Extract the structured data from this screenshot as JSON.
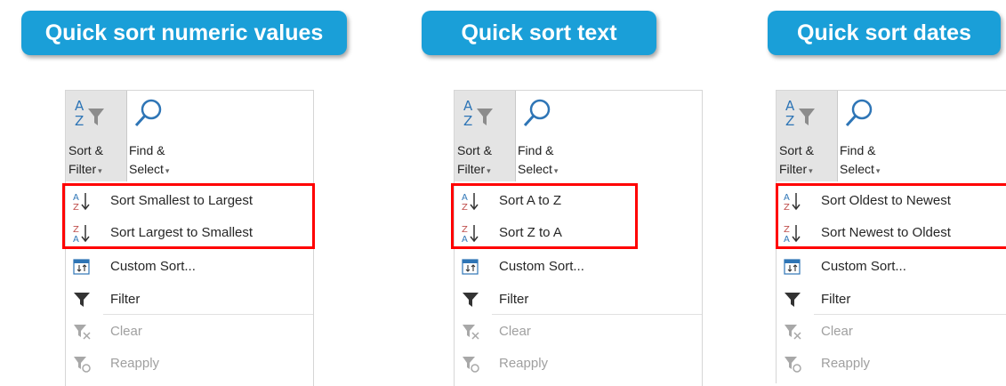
{
  "banners": [
    "Quick sort numeric values",
    "Quick sort text",
    "Quick sort dates"
  ],
  "ribbon": {
    "sort_filter": {
      "line1": "Sort &",
      "line2": "Filter",
      "icon": "sort-filter-icon"
    },
    "find_select": {
      "line1": "Find &",
      "line2": "Select",
      "icon": "magnifier-icon"
    },
    "caret": "▾"
  },
  "panels": [
    {
      "sort_asc": "Sort Smallest to Largest",
      "sort_desc": "Sort Largest to Smallest",
      "custom_sort": "Custom Sort...",
      "filter": "Filter",
      "clear": "Clear",
      "reapply": "Reapply"
    },
    {
      "sort_asc": "Sort A to Z",
      "sort_desc": "Sort Z to A",
      "custom_sort": "Custom Sort...",
      "filter": "Filter",
      "clear": "Clear",
      "reapply": "Reapply"
    },
    {
      "sort_asc": "Sort Oldest to Newest",
      "sort_desc": "Sort Newest to Oldest",
      "custom_sort": "Custom Sort...",
      "filter": "Filter",
      "clear": "Clear",
      "reapply": "Reapply"
    }
  ],
  "colors": {
    "banner": "#1a9fd8",
    "highlight": "#ff0000",
    "sort_a_blue": "#2e75b6",
    "sort_z_red": "#c0504d"
  }
}
